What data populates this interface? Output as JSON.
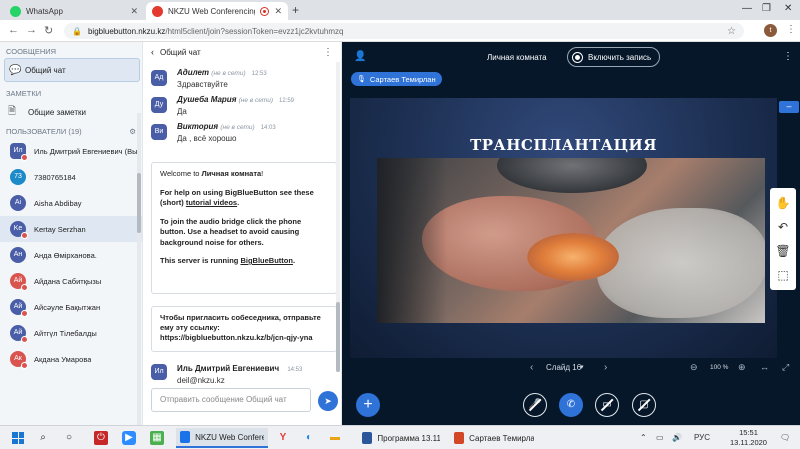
{
  "browser": {
    "tabs": [
      {
        "title": "WhatsApp",
        "active": false
      },
      {
        "title": "NKZU Web Conferencing - /",
        "active": true
      }
    ],
    "new_tab": "+",
    "url_host": "bigbluebutton.nkzu.kz",
    "url_path": "/html5client/join?sessionToken=evzz1jc2kvtuhmzq",
    "profile_initial": "t"
  },
  "sidebar": {
    "messages_heading": "СООБЩЕНИЯ",
    "public_chat_label": "Общий чат",
    "notes_heading": "ЗАМЕТКИ",
    "shared_notes_label": "Общие заметки",
    "users_heading": "ПОЛЬЗОВАТЕЛИ (19)",
    "users": [
      {
        "initials": "Ил",
        "name": "Иль Дмитрий Евгениевич (Вы)",
        "color": "#4a5ea8",
        "round": false,
        "muted": true
      },
      {
        "initials": "73",
        "name": "7380765184",
        "color": "#1b8ac9",
        "round": true,
        "muted": false
      },
      {
        "initials": "Ai",
        "name": "Aisha Abdibay",
        "color": "#4a5ea8",
        "round": true,
        "muted": false
      },
      {
        "initials": "Ke",
        "name": "Kertay Serzhan",
        "color": "#4a5ea8",
        "round": true,
        "muted": true
      },
      {
        "initials": "Ан",
        "name": "Анда Өмірханова.",
        "color": "#4a5ea8",
        "round": true,
        "muted": false
      },
      {
        "initials": "Ай",
        "name": "Айдана Сабитқызы",
        "color": "#d9534f",
        "round": true,
        "muted": true
      },
      {
        "initials": "Ай",
        "name": "Айсәуле Бақытжан",
        "color": "#4a5ea8",
        "round": true,
        "muted": true
      },
      {
        "initials": "Ай",
        "name": "Айтгүл Тілебалды",
        "color": "#4a5ea8",
        "round": true,
        "muted": true
      },
      {
        "initials": "Ак",
        "name": "Акдана Умарова",
        "color": "#d9534f",
        "round": true,
        "muted": true
      }
    ]
  },
  "chat": {
    "title": "Общий чат",
    "messages": [
      {
        "initials": "Ад",
        "name": "Адилет",
        "status": "(не в сети)",
        "time": "12:53",
        "text": "Здравствуйте",
        "color": "#4a5ea8"
      },
      {
        "initials": "Ду",
        "name": "Душеба Мария",
        "status": "(не в сети)",
        "time": "12:59",
        "text": "Да",
        "color": "#4a5ea8"
      },
      {
        "initials": "Ви",
        "name": "Виктория",
        "status": "(не в сети)",
        "time": "14:03",
        "text": "Да , всё хорошо",
        "color": "#4a5ea8"
      }
    ],
    "welcome": {
      "line1_prefix": "Welcome to ",
      "line1_room": "Личная комната",
      "line1_suffix": "!",
      "line2_prefix": "For help on using BigBlueButton see these (short) ",
      "line2_link": "tutorial videos",
      "line2_suffix": ".",
      "line3": "To join the audio bridge click the phone button. Use a headset to avoid causing background noise for others.",
      "line4_prefix": "This server is running ",
      "line4_link": "BigBlueButton",
      "line4_suffix": "."
    },
    "invite": {
      "text": "Чтобы пригласить собеседника, отправьте ему эту ссылку:",
      "link": "https://bigbluebutton.nkzu.kz/b/jcn-qjy-yna"
    },
    "last": {
      "initials": "Ил",
      "name": "Иль Дмитрий Евгениевич",
      "time": "14:53",
      "text": "deil@nkzu.kz"
    },
    "input_placeholder": "Отправить сообщение Общий чат"
  },
  "main": {
    "room_title": "Личная комната",
    "record_label": "Включить запись",
    "presenter": "Сартаев Темирлан",
    "slide_title": "ТРАНСПЛАНТАЦИЯ",
    "slide_label": "Слайд 16",
    "zoom": "100 %"
  },
  "taskbar": {
    "apps": [
      {
        "label": "NKZU Web Conferen...",
        "color": "#1a73e8",
        "icon": "chrome-icon",
        "active": true
      },
      {
        "label": "Программа 13.11....",
        "color": "#2b579a",
        "icon": "word-icon",
        "active": false
      },
      {
        "label": "Сартаев Темирлан...",
        "color": "#d24726",
        "icon": "powerpoint-icon",
        "active": false
      }
    ],
    "lang": "РУС",
    "time": "15:51",
    "date": "13.11.2020"
  }
}
